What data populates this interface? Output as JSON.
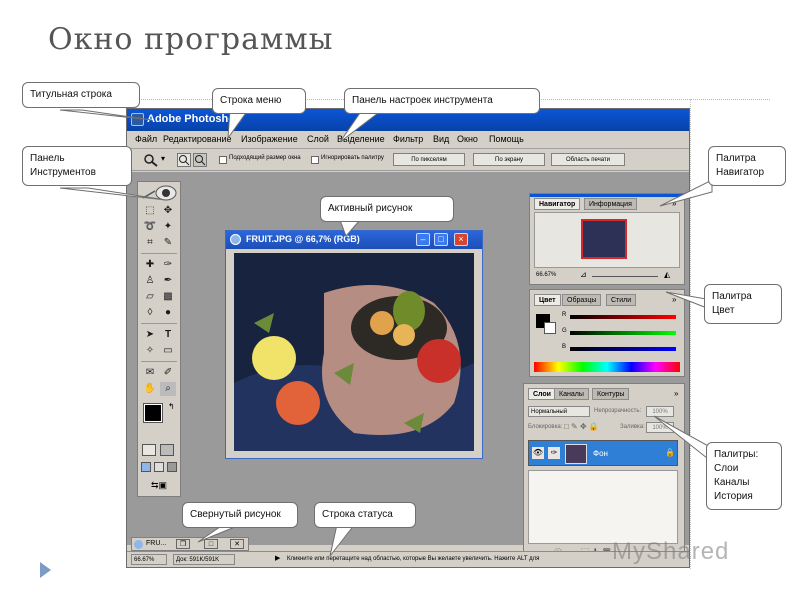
{
  "slide": {
    "title": "Окно программы"
  },
  "window": {
    "title": "Adobe Photoshop",
    "menu": [
      "Файл",
      "Редактирование",
      "Изображение",
      "Слой",
      "Выделение",
      "Фильтр",
      "Вид",
      "Окно",
      "Помощь"
    ],
    "options_bar": {
      "checkbox1": "Подходящий размер окна",
      "checkbox2": "Игнорировать палитру",
      "btn1": "По пикселям",
      "btn2": "По экрану",
      "btn3": "Область печати"
    }
  },
  "image_window": {
    "title": "FRUIT.JPG @ 66,7% (RGB)"
  },
  "navigator": {
    "tabs": [
      "Навигатор",
      "Информация"
    ],
    "zoom": "66.67%"
  },
  "color_palette": {
    "tabs": [
      "Цвет",
      "Образцы",
      "Стили"
    ],
    "channels": [
      "R",
      "G",
      "B"
    ]
  },
  "layers_palette": {
    "tabs": [
      "Слои",
      "Каналы",
      "Контуры"
    ],
    "blend_mode": "Нормальный",
    "opacity_label": "Непрозрачность:",
    "opacity_value": "100%",
    "lock_label": "Блокировка:",
    "fill_label": "Заливка:",
    "fill_value": "100%",
    "layer_name": "Фон"
  },
  "minimized_doc": {
    "label": "FRU..."
  },
  "status": {
    "zoom": "66.67%",
    "doc": "Док: 591K/591K",
    "hint": "Кликните или перетащите над областью, которые Вы желаете увеличить. Нажите ALT для"
  },
  "callouts": {
    "title_bar": "Титульная строка",
    "menu_bar": "Строка меню",
    "options": "Панель настроек инструмента",
    "toolbox": "Панель Инструментов",
    "navigator": "Палитра Навигатор",
    "active_image": "Активный рисунок",
    "color": "Палитра Цвет",
    "layers": "Палитры: Слои Каналы История",
    "minimized": "Свернутый рисунок",
    "status_bar": "Строка статуса"
  },
  "watermark": "MyShared",
  "colors": {
    "titlebar": "#0a55d6",
    "workspace": "#9a9a9a",
    "panel": "#d4d0c8",
    "layer_selected": "#2f7fd6"
  }
}
